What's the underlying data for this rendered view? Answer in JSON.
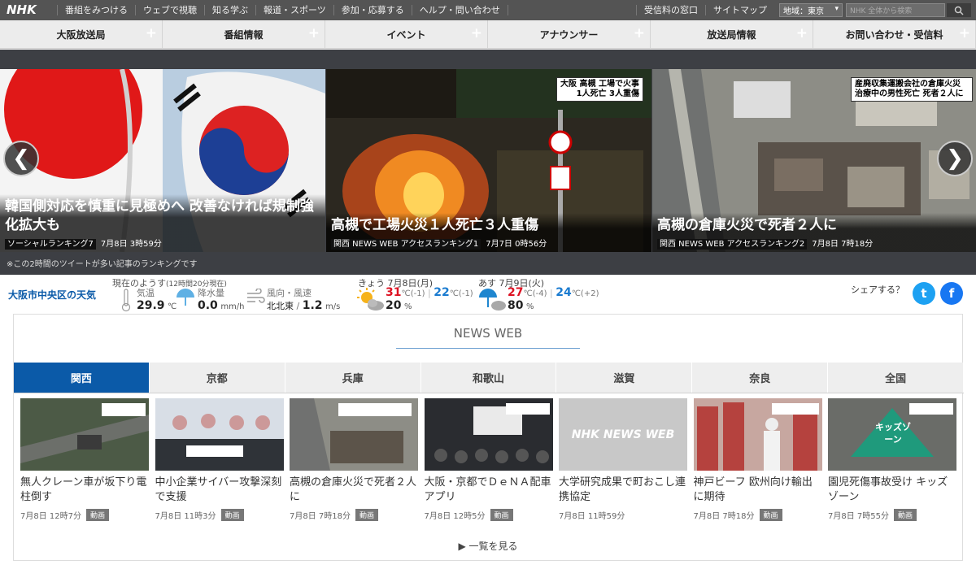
{
  "header": {
    "logo": "NHK",
    "links": [
      "番組をみつける",
      "ウェブで視聴",
      "知る学ぶ",
      "報道・スポーツ",
      "参加・応募する",
      "ヘルプ・問い合わせ"
    ],
    "right_links": [
      "受信料の窓口",
      "サイトマップ"
    ],
    "region_label": "地域：東京",
    "search_placeholder": "NHK 全体から検索"
  },
  "localnav": {
    "items": [
      "大阪放送局",
      "番組情報",
      "イベント",
      "アナウンサー",
      "放送局情報",
      "お問い合わせ・受信料"
    ]
  },
  "carousel": {
    "slides": [
      {
        "headline": "韓国側対応を慎重に見極めへ 改善なければ規制強化拡大も",
        "tag": "ソーシャルランキング7",
        "time": "7月8日 3時59分"
      },
      {
        "headline": "高槻で工場火災１人死亡３人重傷",
        "tag": "関西 NEWS WEB アクセスランキング1",
        "time": "7月7日 0時56分",
        "overlay": [
          "大阪 高槻 工場で火事",
          "1人死亡 3人重傷"
        ]
      },
      {
        "headline": "高槻の倉庫火災で死者２人に",
        "tag": "関西 NEWS WEB アクセスランキング2",
        "time": "7月8日 7時18分",
        "overlay": [
          "産廃収集運搬会社の倉庫火災",
          "治療中の男性死亡 死者２人に"
        ]
      }
    ],
    "note": "※この2時間のツイートが多い記事のランキングです"
  },
  "weather": {
    "city": "大阪市中央区の天気",
    "now_label": "現在のようす",
    "now_time": "(12時間20分現在)",
    "temp_label": "気温",
    "temp_value": "29.9",
    "temp_unit": "℃",
    "rain_label": "降水量",
    "rain_value": "0.0",
    "rain_unit": "mm/h",
    "wind_label": "風向・風速",
    "wind_dir": "北北東",
    "wind_value": "1.2",
    "wind_unit": "m/s",
    "today": {
      "label": "きょう 7月8日(月)",
      "high": "31",
      "high_diff": "℃(-1)",
      "low": "22",
      "low_diff": "℃(-1)",
      "pop": "20",
      "pop_unit": "%"
    },
    "tomorrow": {
      "label": "あす 7月9日(火)",
      "high": "27",
      "high_diff": "℃(-4)",
      "low": "24",
      "low_diff": "℃(+2)",
      "pop": "80",
      "pop_unit": "%"
    },
    "share_label": "シェアする？"
  },
  "newsweb": {
    "title": "NEWS WEB",
    "tabs": [
      "関西",
      "京都",
      "兵庫",
      "和歌山",
      "滋賀",
      "奈良",
      "全国"
    ],
    "cards": [
      {
        "title": "無人クレーン車が坂下り電柱倒す",
        "time": "7月8日 12時7分",
        "badge": "動画"
      },
      {
        "title": "中小企業サイバー攻撃深刻で支援",
        "time": "7月8日 11時3分",
        "badge": "動画"
      },
      {
        "title": "高槻の倉庫火災で死者２人に",
        "time": "7月8日 7時18分",
        "badge": "動画"
      },
      {
        "title": "大阪・京都でＤｅＮＡ配車アプリ",
        "time": "7月8日 12時5分",
        "badge": "動画"
      },
      {
        "title": "大学研究成果で町おこし連携協定",
        "time": "7月8日 11時59分",
        "badge": ""
      },
      {
        "title": "神戸ビーフ 欧州向け輸出に期待",
        "time": "7月8日 7時18分",
        "badge": "動画"
      },
      {
        "title": "園児死傷事故受け キッズゾーン",
        "time": "7月8日 7時55分",
        "badge": "動画"
      }
    ],
    "nhk_newsweb_logo": "NHK NEWS WEB",
    "kids_zone_text": "キッズゾーン",
    "more_label": "一覧を見る"
  },
  "colors": {
    "topbar": "#545454",
    "accent_blue": "#0b5aa8",
    "carousel_bg": "#3d3f44",
    "hi_red": "#dd1122",
    "lo_blue": "#1a7bd0"
  }
}
